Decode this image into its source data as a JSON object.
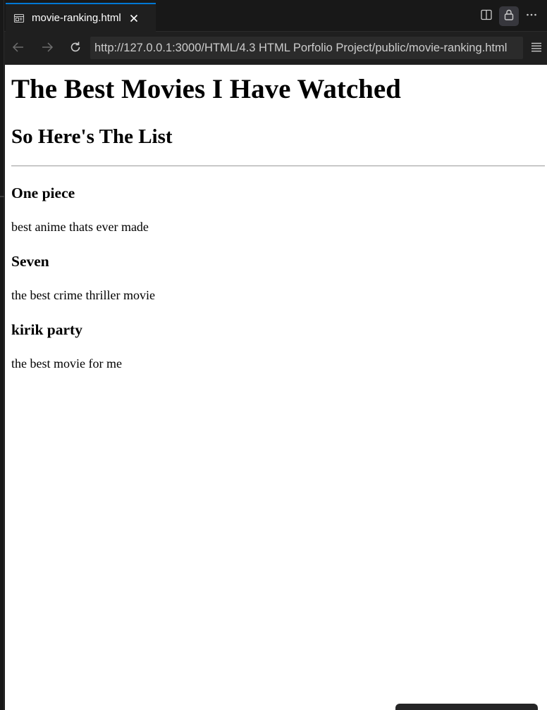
{
  "tab": {
    "title": "movie-ranking.html",
    "icon": "browser-preview-icon",
    "close_icon": "close-icon"
  },
  "tab_actions": [
    {
      "icon": "split-editor-icon"
    },
    {
      "icon": "lock-icon"
    },
    {
      "icon": "more-actions-icon"
    }
  ],
  "nav": {
    "back_icon": "arrow-left-icon",
    "forward_icon": "arrow-right-icon",
    "reload_icon": "reload-icon",
    "url": "http://127.0.0.1:3000/HTML/4.3 HTML Porfolio Project/public/movie-ranking.html",
    "menu_icon": "hamburger-menu-icon"
  },
  "page": {
    "heading": "The Best Movies I Have Watched",
    "subheading": "So Here's The List",
    "movies": [
      {
        "title": "One piece",
        "description": "best anime thats ever made"
      },
      {
        "title": "Seven",
        "description": "the best crime thriller movie"
      },
      {
        "title": "kirik party",
        "description": "the best movie for me"
      }
    ]
  },
  "colors": {
    "accent": "#0078d4",
    "chrome_background": "#181818",
    "url_field_background": "#2b2b2b",
    "page_background": "#ffffff"
  }
}
